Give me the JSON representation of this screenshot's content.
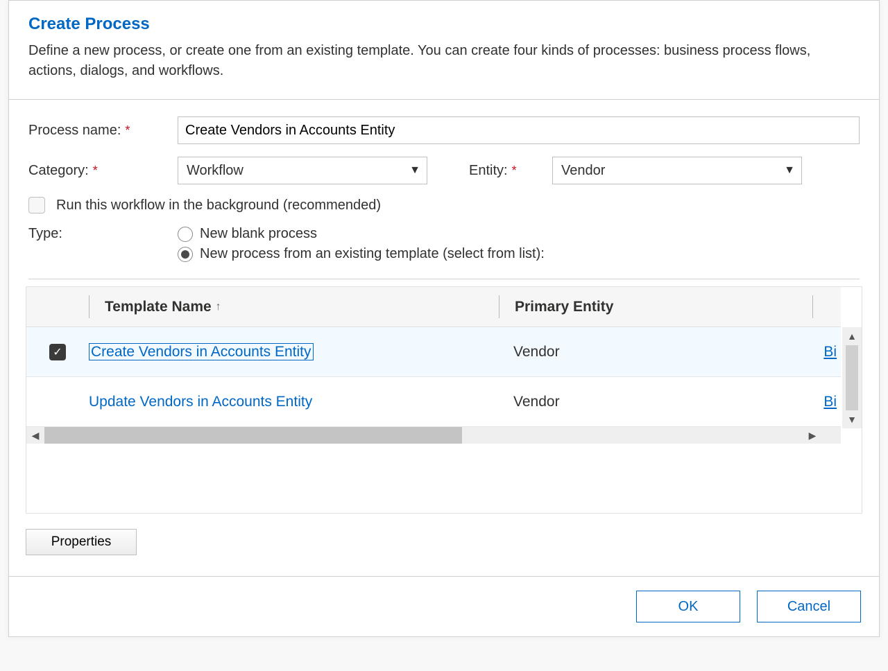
{
  "header": {
    "title": "Create Process",
    "description": "Define a new process, or create one from an existing template. You can create four kinds of processes: business process flows, actions, dialogs, and workflows."
  },
  "form": {
    "process_name_label": "Process name:",
    "process_name_value": "Create Vendors in Accounts Entity",
    "category_label": "Category:",
    "category_value": "Workflow",
    "entity_label": "Entity:",
    "entity_value": "Vendor",
    "background_label": "Run this workflow in the background (recommended)",
    "background_checked": false,
    "type_label": "Type:",
    "type_options": {
      "blank": "New blank process",
      "template": "New process from an existing template (select from list):"
    },
    "type_selected": "template"
  },
  "grid": {
    "columns": {
      "name": "Template Name",
      "entity": "Primary Entity"
    },
    "sort_indicator": "↑",
    "rows": [
      {
        "selected": true,
        "name": "Create Vendors in Accounts Entity",
        "entity": "Vendor",
        "owner_peek": "Bi"
      },
      {
        "selected": false,
        "name": "Update Vendors in Accounts Entity",
        "entity": "Vendor",
        "owner_peek": "Bi"
      }
    ]
  },
  "buttons": {
    "properties": "Properties",
    "ok": "OK",
    "cancel": "Cancel"
  },
  "glyphs": {
    "caret_down": "▼",
    "check": "✓",
    "arrow_up": "▲",
    "arrow_down": "▼",
    "arrow_left": "◀",
    "arrow_right": "▶"
  }
}
